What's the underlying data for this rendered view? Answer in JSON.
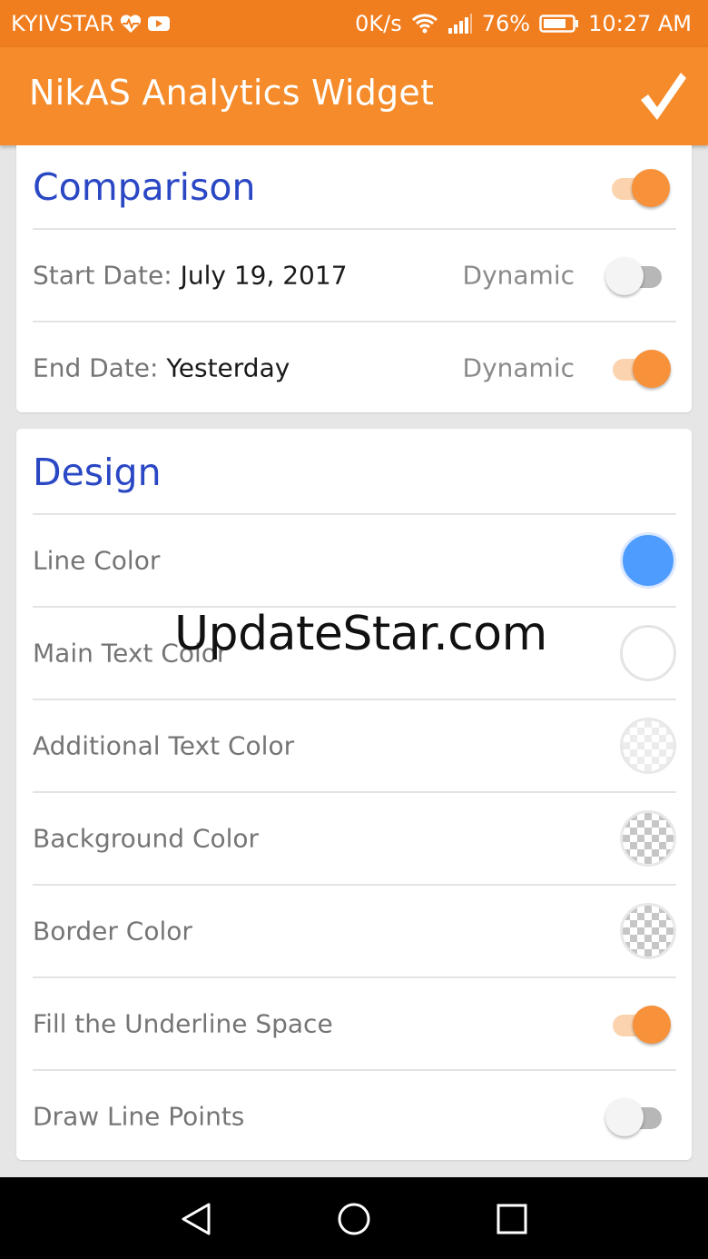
{
  "status_bar": {
    "carrier": "KYIVSTAR",
    "network_speed": "0K/s",
    "battery_percent": "76%",
    "time": "10:27 AM",
    "icons": [
      "heart-pulse-icon",
      "youtube-icon",
      "wifi-icon",
      "signal-icon",
      "battery-icon"
    ]
  },
  "app_bar": {
    "title": "NikAS Analytics Widget",
    "confirm_icon": "checkmark-icon"
  },
  "comparison": {
    "title": "Comparison",
    "enabled": true,
    "start_date": {
      "label": "Start Date: ",
      "value": "July 19, 2017",
      "dynamic_label": "Dynamic",
      "dynamic": false
    },
    "end_date": {
      "label": "End Date: ",
      "value": "Yesterday",
      "dynamic_label": "Dynamic",
      "dynamic": true
    }
  },
  "design": {
    "title": "Design",
    "line_color": {
      "label": "Line Color",
      "color": "#4f9cff"
    },
    "main_text_color": {
      "label": "Main Text Color",
      "color": "#ffffff"
    },
    "additional_text_color": {
      "label": "Additional Text Color",
      "color": "transparent-light"
    },
    "background_color": {
      "label": "Background Color",
      "color": "transparent"
    },
    "border_color": {
      "label": "Border Color",
      "color": "transparent"
    },
    "fill_underline": {
      "label": "Fill the Underline Space",
      "enabled": true
    },
    "draw_points": {
      "label": "Draw Line Points",
      "enabled": false
    }
  },
  "watermark": "UpdateStar.com",
  "nav_bar": {
    "icons": [
      "back-icon",
      "home-icon",
      "recents-icon"
    ]
  },
  "colors": {
    "accent": "#f58b2a",
    "status_bar": "#f07d1e",
    "section_title": "#2a47c4"
  }
}
